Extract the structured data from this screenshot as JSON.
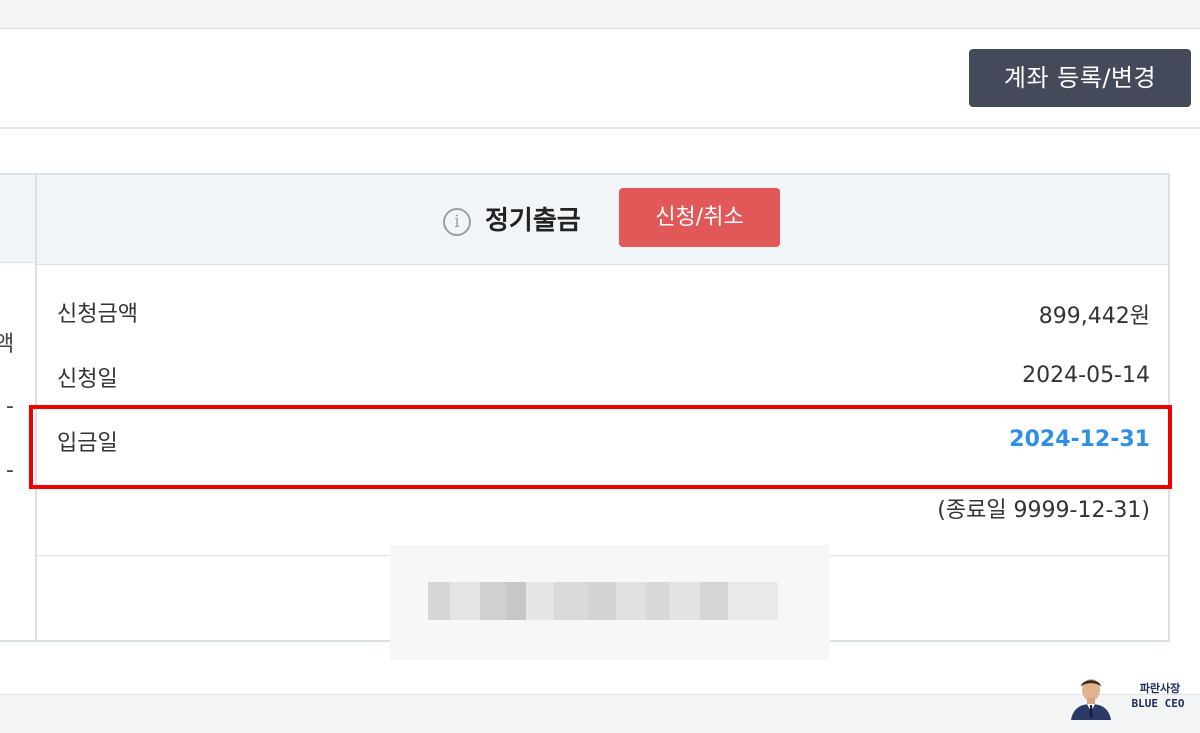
{
  "header": {
    "account_button": "계좌 등록/변경"
  },
  "left_column": {
    "cut_label": "액",
    "dash_1": "-",
    "dash_2": "-"
  },
  "panel": {
    "title": "정기출금",
    "info_icon": "info-icon",
    "apply_button": "신청/취소",
    "rows": [
      {
        "label": "신청금액",
        "value": "899,442원"
      },
      {
        "label": "신청일",
        "value": "2024-05-14"
      },
      {
        "label": "입금일",
        "value": "2024-12-31"
      }
    ],
    "end_note": "(종료일 9999-12-31)"
  },
  "watermark": {
    "korean": "파란사장",
    "english": "BLUE CEO"
  },
  "colors": {
    "account_button_bg": "#444a59",
    "apply_button_bg": "#e25757",
    "highlight_value": "#2f8fe6",
    "highlight_border": "#f00000"
  }
}
